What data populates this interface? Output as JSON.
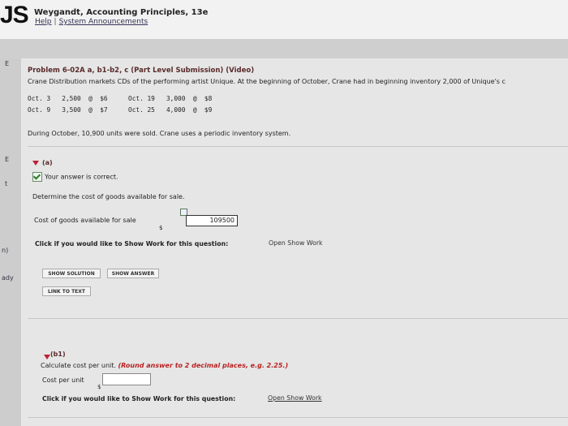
{
  "header": {
    "logo_text": "JS",
    "book_title": "Weygandt, Accounting Principles, 13e",
    "help_link": "Help",
    "separator": "|",
    "system_link": "System Announcements"
  },
  "sidebar": {
    "marks": [
      "E",
      "E",
      "t",
      "t",
      "n)",
      "ady"
    ]
  },
  "problem": {
    "title": "Problem 6-02A a, b1-b2, c (Part Level Submission) (Video)",
    "description": "Crane Distribution markets CDs of the performing artist Unique. At the beginning of October, Crane had in beginning inventory 2,000 of Unique's c",
    "purchases": [
      {
        "date": "Oct. 3",
        "units": "2,500",
        "at": "@",
        "price": "$6"
      },
      {
        "date": "Oct. 9",
        "units": "3,500",
        "at": "@",
        "price": "$7"
      },
      {
        "date": "Oct. 19",
        "units": "3,000",
        "at": "@",
        "price": "$8"
      },
      {
        "date": "Oct. 25",
        "units": "4,000",
        "at": "@",
        "price": "$9"
      }
    ],
    "sold_text": "During October, 10,900 units were sold. Crane uses a periodic inventory system."
  },
  "part_a": {
    "label": "(a)",
    "correct_text": "Your answer is correct.",
    "instruction": "Determine the cost of goods available for sale.",
    "field_label": "Cost of goods available for sale",
    "currency": "$",
    "value": "109500",
    "show_work_prompt": "Click if you would like to Show Work for this question:",
    "open_show_work": "Open Show Work",
    "buttons": {
      "show_solution": "SHOW SOLUTION",
      "show_answer": "SHOW ANSWER",
      "link_to_text": "LINK TO TEXT"
    }
  },
  "part_b1": {
    "label": "(b1)",
    "instruction_start": "Calculate cost per unit.",
    "instruction_hint": "(Round answer to 2 decimal places, e.g. 2.25.)",
    "field_label": "Cost per unit",
    "currency": "$",
    "value": "",
    "show_work_prompt": "Click if you would like to Show Work for this question:",
    "open_show_work": "Open Show Work"
  }
}
